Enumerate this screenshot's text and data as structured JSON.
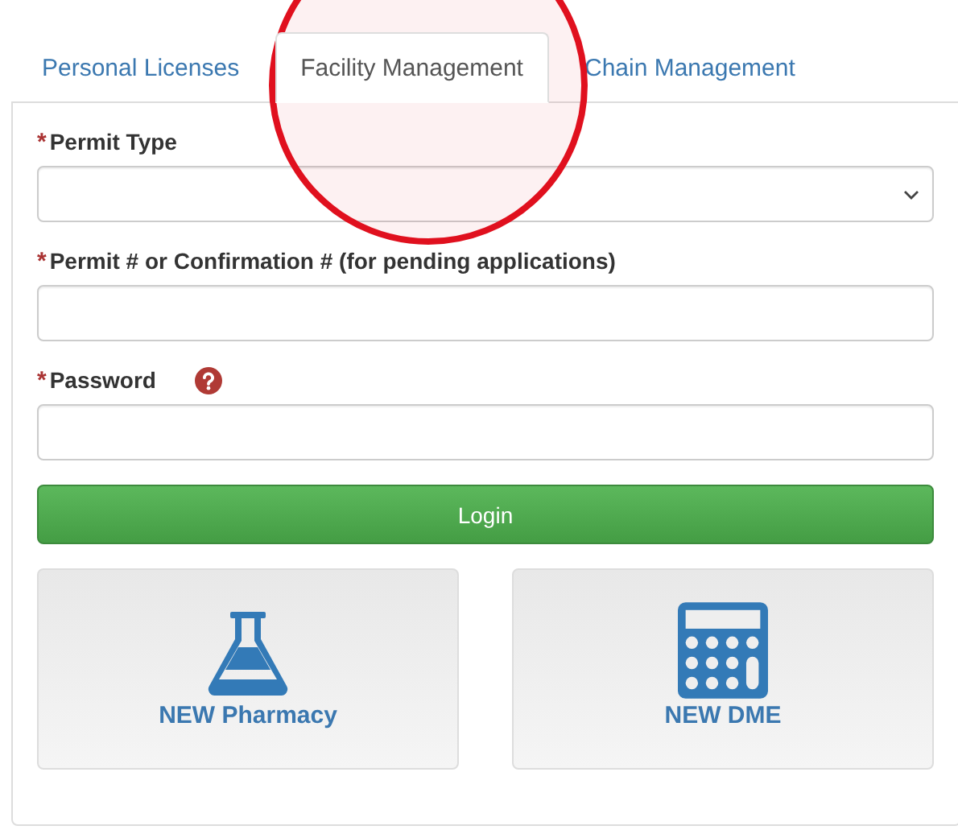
{
  "tabs": [
    {
      "label": "Personal Licenses",
      "selected": false,
      "circled": false
    },
    {
      "label": "Facility Management",
      "selected": true,
      "circled": true
    },
    {
      "label": "Chain Management",
      "selected": false,
      "circled": false
    }
  ],
  "fields": [
    {
      "kind": "select",
      "label": "Permit Type",
      "required": true,
      "help": false
    },
    {
      "kind": "text",
      "label": "Permit # or Confirmation # (for pending applications)",
      "required": true,
      "help": false
    },
    {
      "kind": "password",
      "label": "Password",
      "required": true,
      "help": true
    }
  ],
  "required_mark": "*",
  "login_button": "Login",
  "tiles": [
    {
      "kind": "flask",
      "label": "NEW Pharmacy"
    },
    {
      "kind": "calculator",
      "label": "NEW DME"
    }
  ]
}
